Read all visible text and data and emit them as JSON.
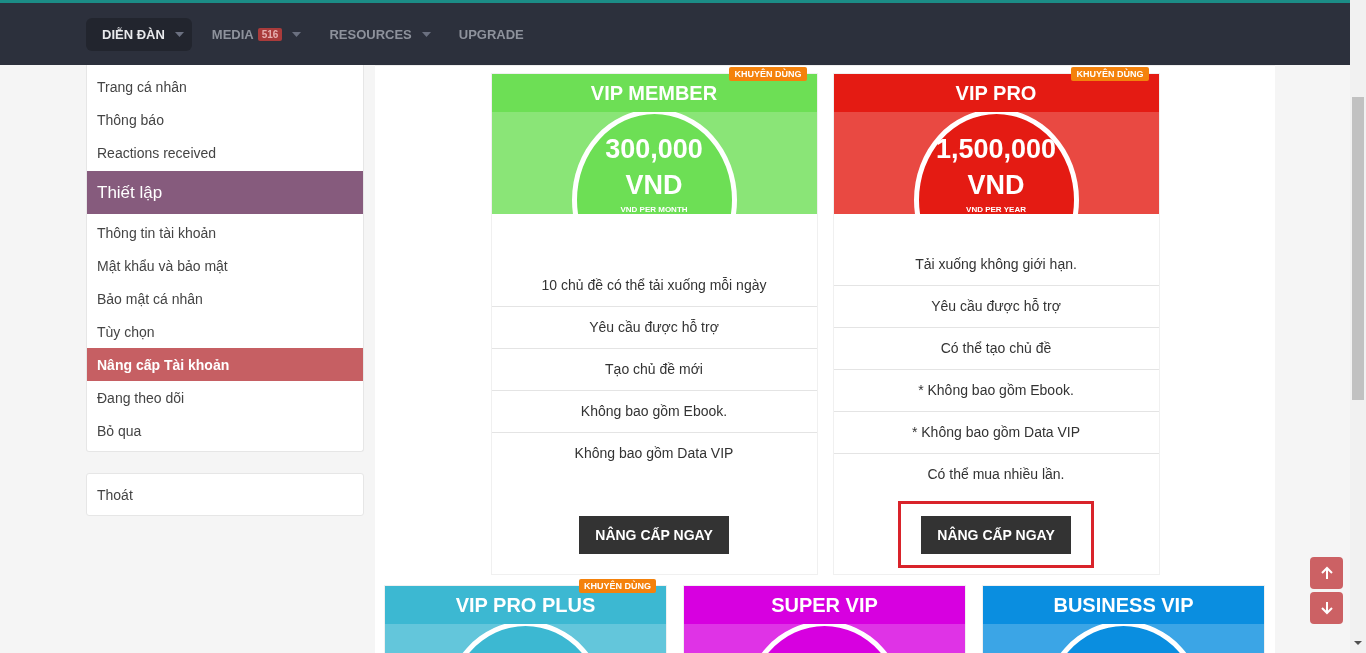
{
  "nav": {
    "items": [
      {
        "label": "DIỄN ĐÀN",
        "selected": true,
        "dropdown": true
      },
      {
        "label": "MEDIA",
        "selected": false,
        "dropdown": true,
        "badge": "516"
      },
      {
        "label": "RESOURCES",
        "selected": false,
        "dropdown": true
      },
      {
        "label": "UPGRADE",
        "selected": false,
        "dropdown": false
      }
    ]
  },
  "sidebar": {
    "groups": [
      {
        "items": [
          {
            "label": "Trang cá nhân",
            "kind": "item",
            "selected": false
          },
          {
            "label": "Thông báo",
            "kind": "item",
            "selected": false
          },
          {
            "label": "Reactions received",
            "kind": "item",
            "selected": false
          },
          {
            "label": "Thiết lập",
            "kind": "heading"
          },
          {
            "label": "Thông tin tài khoản",
            "kind": "item",
            "selected": false
          },
          {
            "label": "Mật khẩu và bảo mật",
            "kind": "item",
            "selected": false
          },
          {
            "label": "Bảo mật cá nhân",
            "kind": "item",
            "selected": false
          },
          {
            "label": "Tùy chọn",
            "kind": "item",
            "selected": false
          },
          {
            "label": "Nâng cấp Tài khoản",
            "kind": "item",
            "selected": true
          },
          {
            "label": "Đang theo dõi",
            "kind": "item",
            "selected": false
          },
          {
            "label": "Bỏ qua",
            "kind": "item",
            "selected": false
          }
        ]
      },
      {
        "items": [
          {
            "label": "Thoát",
            "kind": "item",
            "selected": false
          }
        ]
      }
    ]
  },
  "plans": [
    {
      "title": "VIP MEMBER",
      "color": "#6ddf55",
      "badge": "KHUYÊN DÙNG",
      "price": "300,000",
      "currency": "VND",
      "period": "VND PER MONTH",
      "features": [
        "10 chủ đề có thể tải xuống mỗi ngày",
        "Yêu cầu được hỗ trợ",
        "Tạo chủ đề mới",
        "Không bao gồm Ebook.",
        "Không bao gồm Data VIP"
      ],
      "button": "NÂNG CẤP NGAY",
      "highlighted": false
    },
    {
      "title": "VIP PRO",
      "color": "#e41b13",
      "badge": "KHUYÊN DÙNG",
      "price": "1,500,000",
      "currency": "VND",
      "period": "VND PER YEAR",
      "features": [
        "Tải xuống không giới hạn.",
        "Yêu cầu được hỗ trợ",
        "Có thể tạo chủ đề",
        "* Không bao gồm Ebook.",
        "* Không bao gồm Data VIP",
        "Có thể mua nhiều lần."
      ],
      "button": "NÂNG CẤP NGAY",
      "highlighted": true
    },
    {
      "title": "VIP PRO PLUS",
      "color": "#3cb8d2",
      "badge": "KHUYÊN DÙNG"
    },
    {
      "title": "SUPER VIP",
      "color": "#d700e0"
    },
    {
      "title": "BUSINESS VIP",
      "color": "#0a8ee0"
    }
  ]
}
